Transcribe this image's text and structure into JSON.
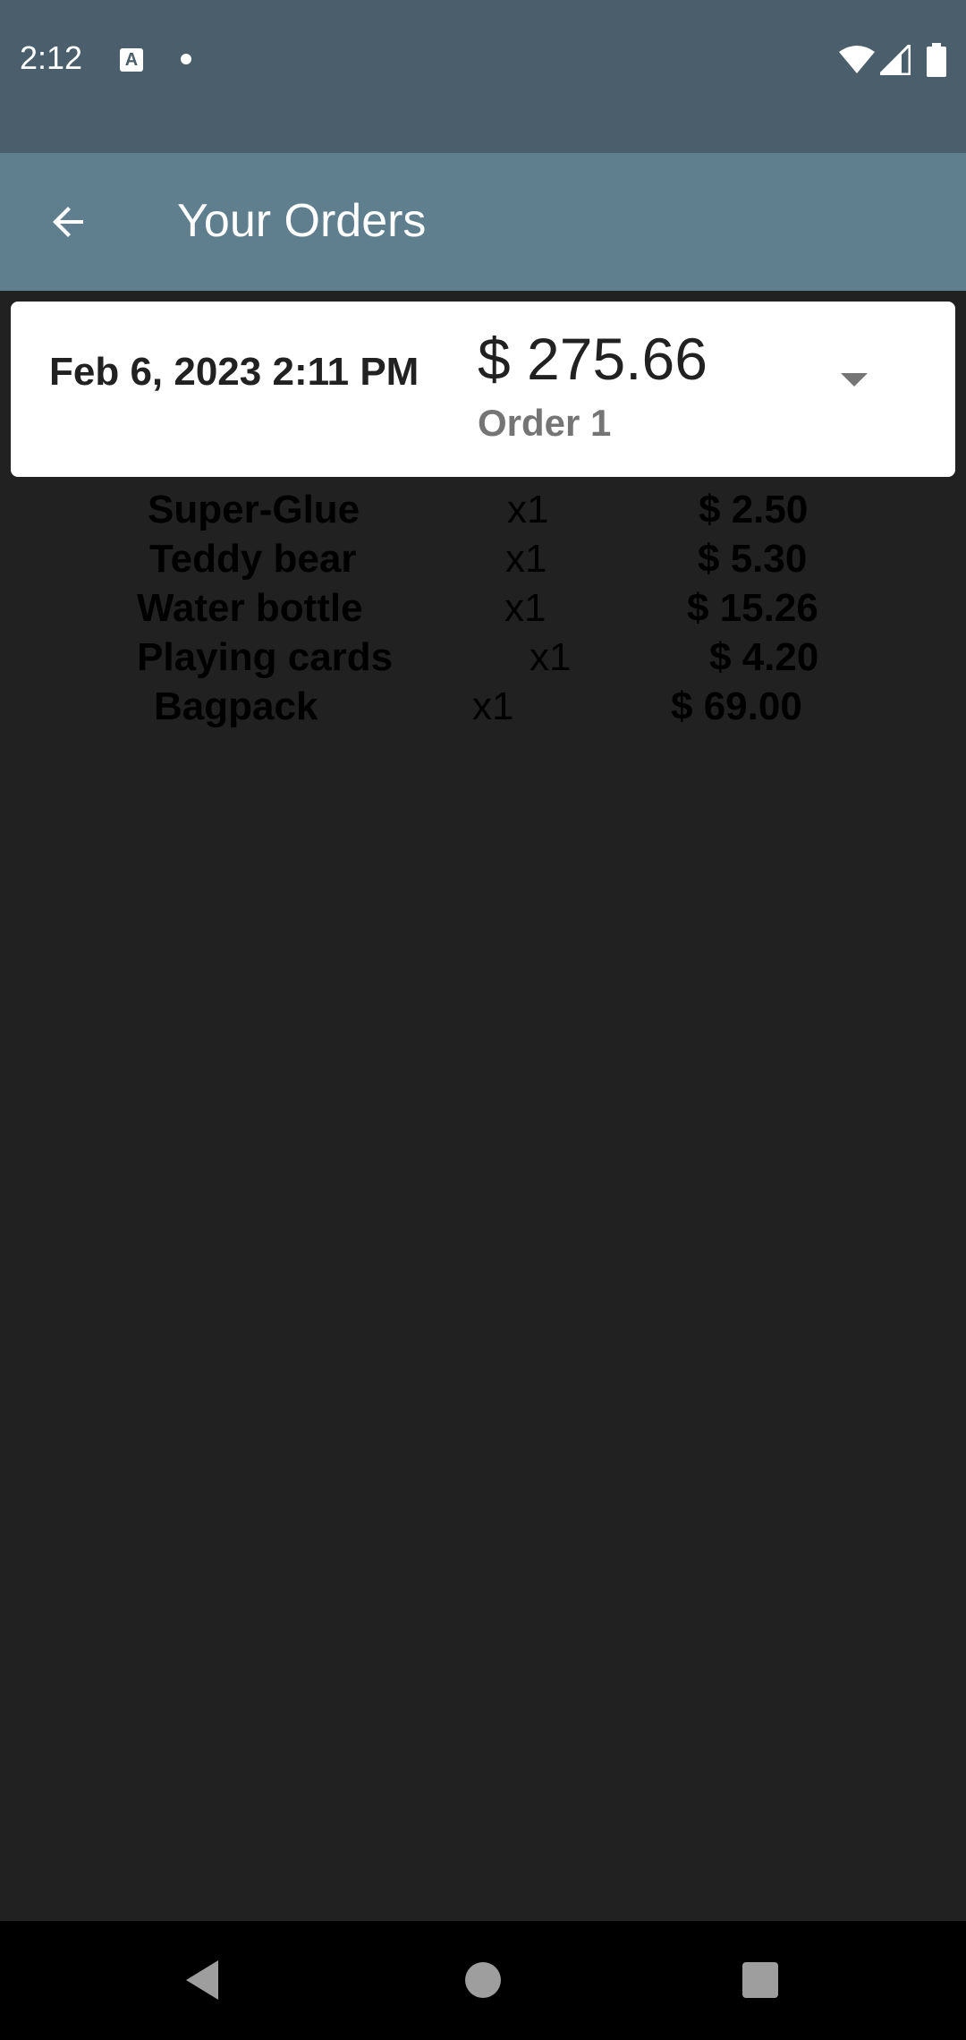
{
  "status_bar": {
    "time": "2:12",
    "icons": [
      "a-icon",
      "notification-dot-icon",
      "wifi-icon",
      "signal-icon",
      "battery-icon"
    ]
  },
  "app_bar": {
    "title": "Your Orders",
    "back_icon": "arrow-left-icon"
  },
  "order": {
    "date": "Feb 6, 2023 2:11 PM",
    "total": "$ 275.66",
    "name": "Order 1",
    "expand_icon": "dropdown-arrow-icon"
  },
  "items": [
    {
      "name": "Super-Glue",
      "qty": "x1",
      "price": "$ 2.50"
    },
    {
      "name": "Teddy bear",
      "qty": "x1",
      "price": "$ 5.30"
    },
    {
      "name": "Water bottle",
      "qty": "x1",
      "price": "$ 15.26"
    },
    {
      "name": "Playing cards",
      "qty": "x1",
      "price": "$ 4.20"
    },
    {
      "name": "Bagpack",
      "qty": "x1",
      "price": "$ 69.00"
    }
  ],
  "nav_bar": {
    "icons": [
      "nav-back-icon",
      "nav-home-icon",
      "nav-recents-icon"
    ]
  },
  "colors": {
    "status_bar": "#4a5f6b",
    "app_bar": "#5f7e8e",
    "background": "#212121",
    "card": "#ffffff"
  }
}
